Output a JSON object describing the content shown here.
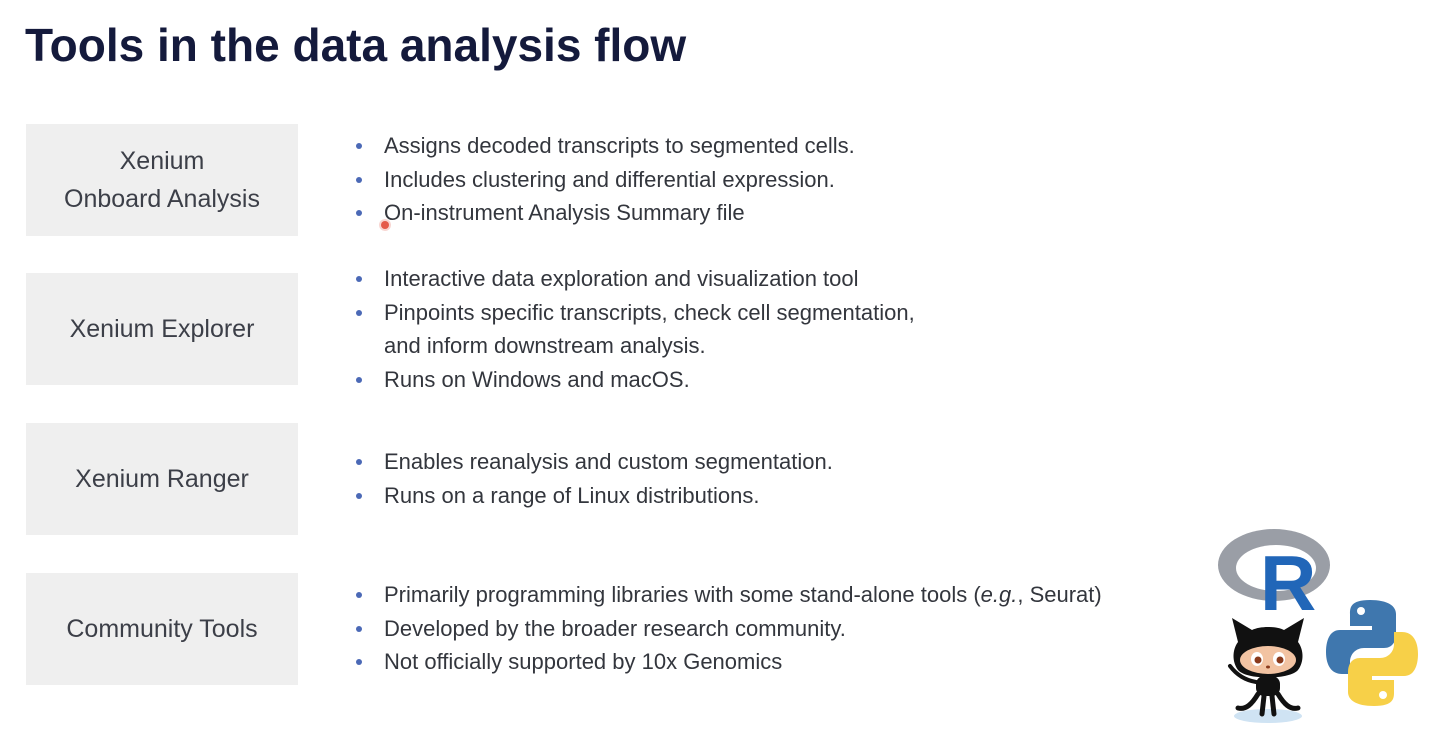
{
  "title": "Tools in the data analysis flow",
  "tools": [
    {
      "name_lines": [
        "Xenium",
        "Onboard Analysis"
      ],
      "bullets": [
        "Assigns decoded transcripts to segmented cells.",
        "Includes clustering and differential expression.",
        "On-instrument Analysis Summary file"
      ]
    },
    {
      "name_lines": [
        "Xenium Explorer"
      ],
      "bullets": [
        "Interactive data exploration and visualization tool",
        "Pinpoints specific transcripts, check cell segmentation,",
        "and inform downstream analysis.",
        "Runs on Windows and macOS."
      ]
    },
    {
      "name_lines": [
        "Xenium Ranger"
      ],
      "bullets": [
        "Enables reanalysis and custom segmentation.",
        "Runs on a range of Linux distributions."
      ]
    },
    {
      "name_lines": [
        "Community Tools"
      ],
      "bullets": [
        "Primarily programming libraries with some stand-alone tools (",
        "e.g.",
        ", Seurat)",
        "Developed by the broader research community.",
        "Not officially supported by 10x Genomics"
      ]
    }
  ],
  "logos": {
    "r_letter": "R",
    "icons": [
      "r-logo-icon",
      "github-octocat-icon",
      "python-logo-icon"
    ]
  },
  "colors": {
    "title": "#141a3c",
    "box_bg": "#efefef",
    "bullet_dot": "#4b69b6",
    "text": "#33363d",
    "r_blue": "#2166b8",
    "python_blue": "#3f77ae",
    "python_yellow": "#f7d048"
  }
}
